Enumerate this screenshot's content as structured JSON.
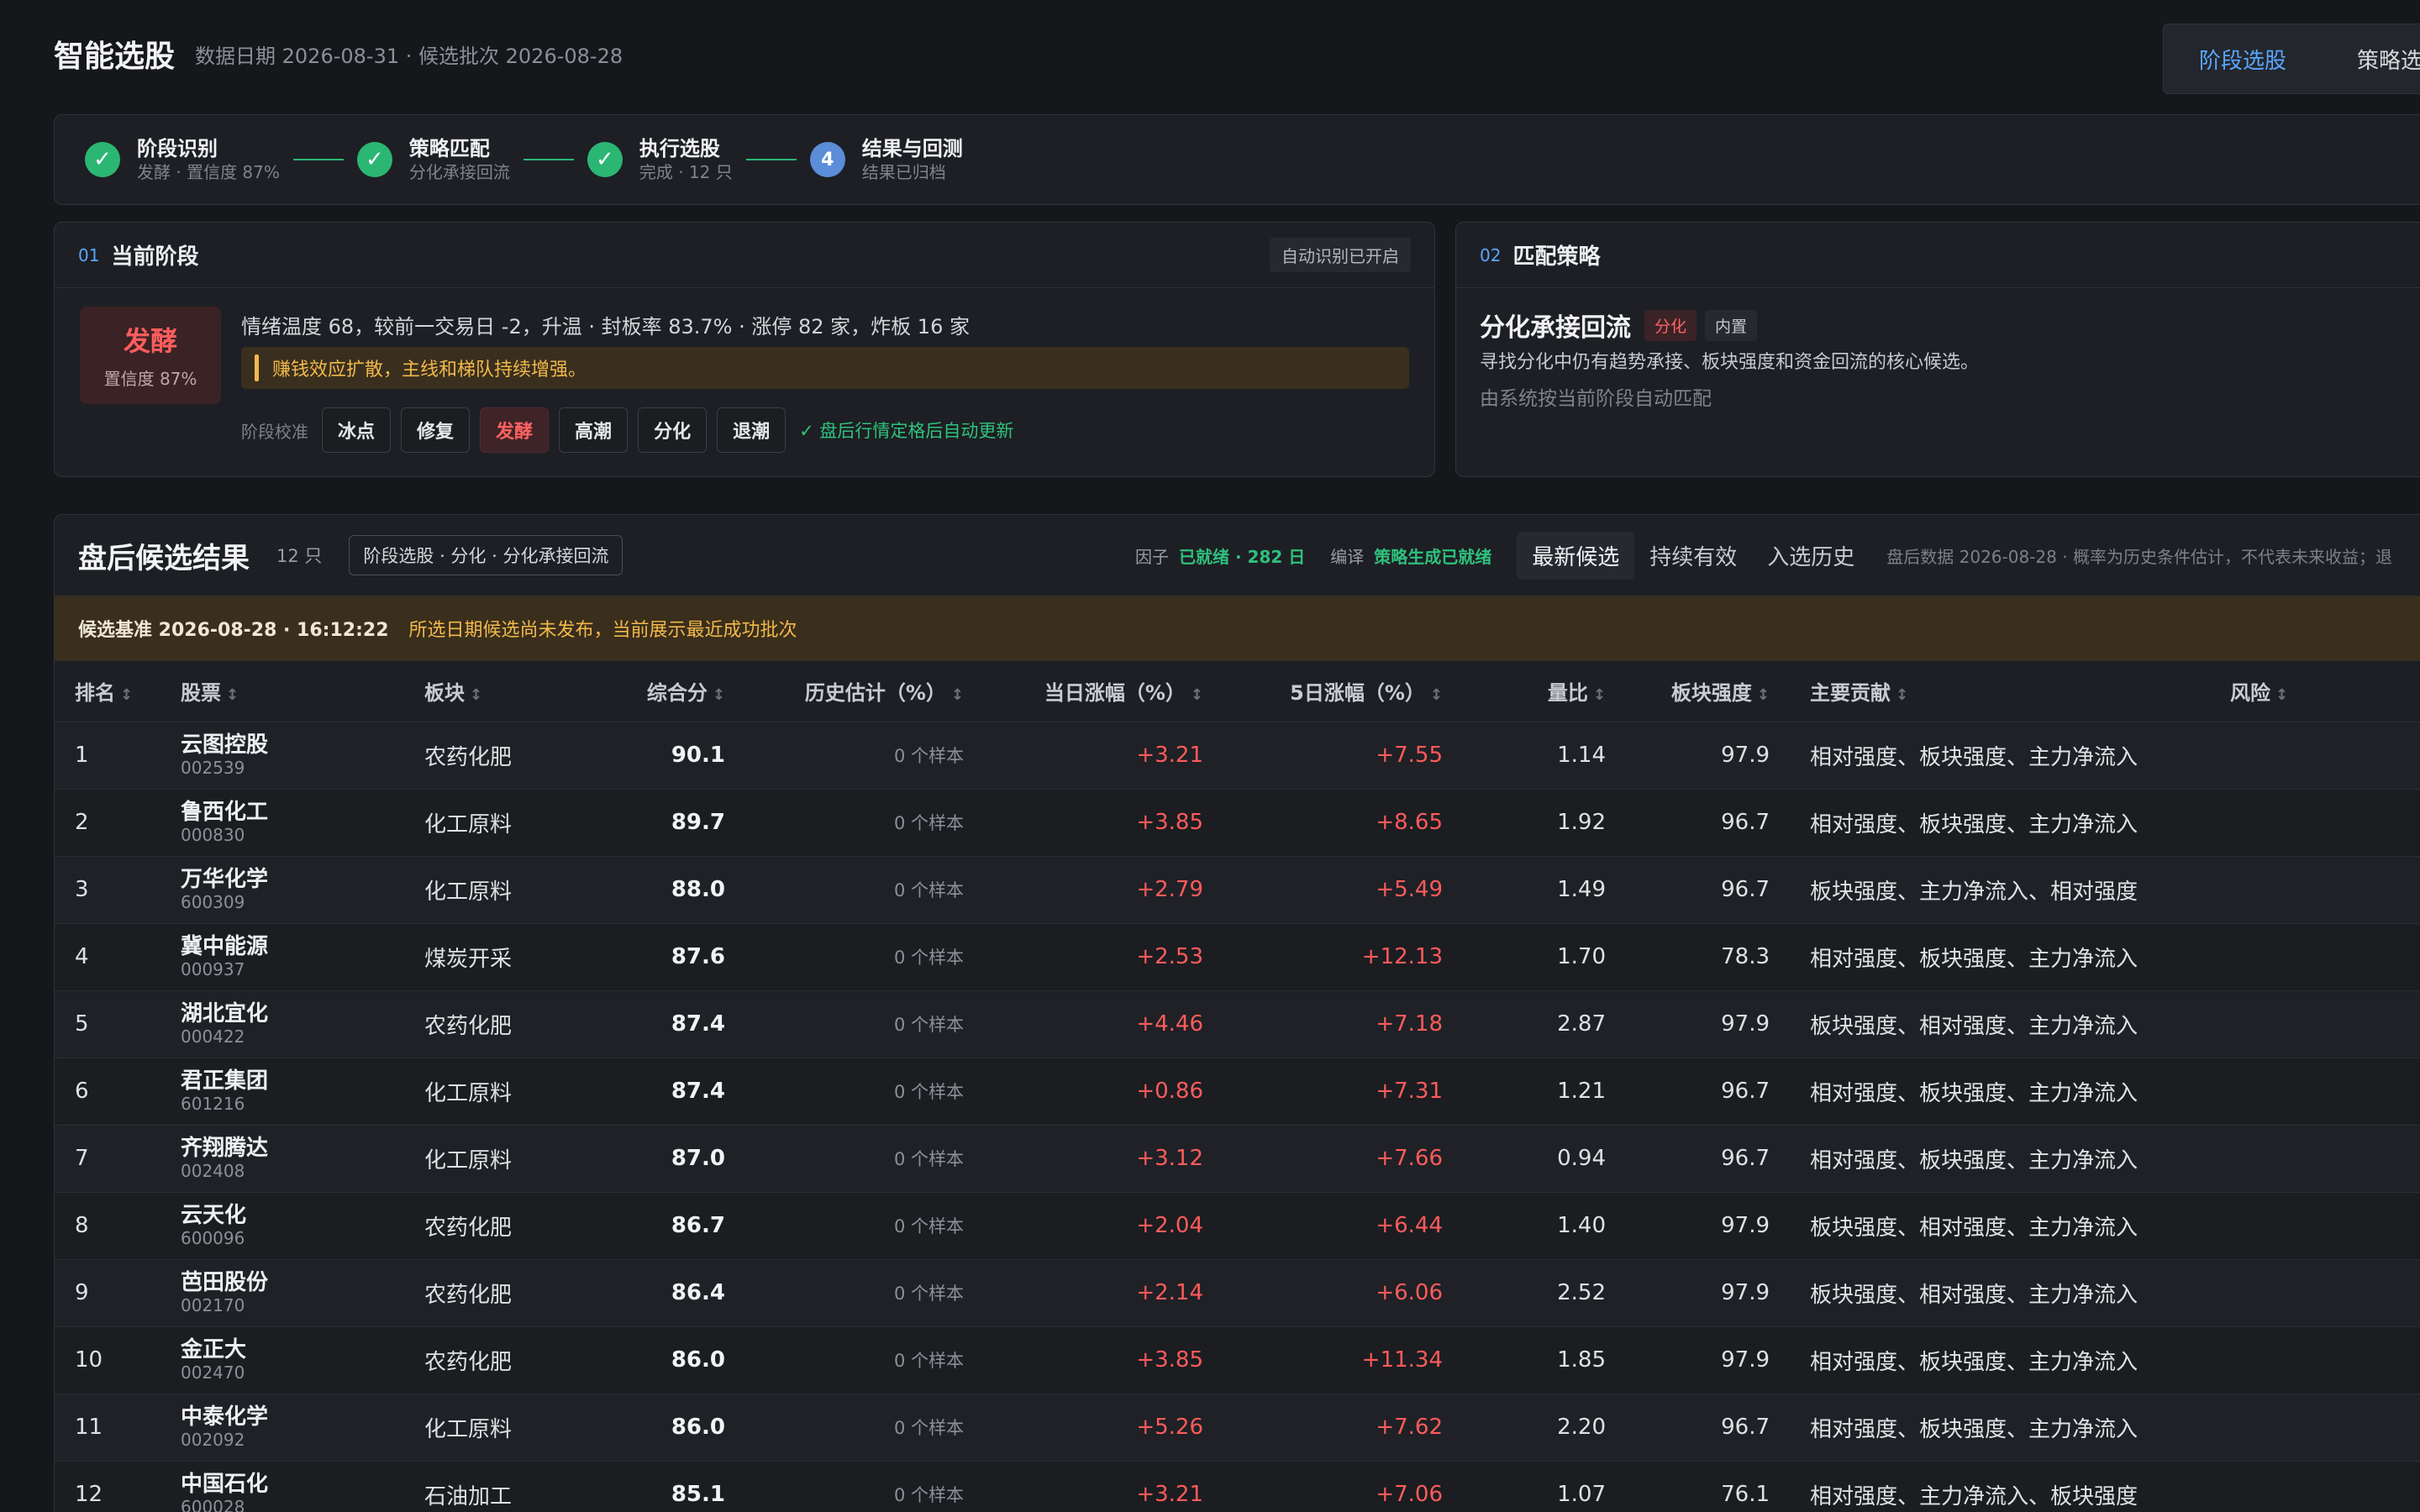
{
  "header": {
    "title": "智能选股",
    "meta": "数据日期 2026-08-31 · 候选批次 2026-08-28",
    "tabs": [
      "阶段选股",
      "策略选股"
    ]
  },
  "stepper": [
    {
      "title": "阶段识别",
      "sub": "发酵 · 置信度 87%",
      "state": "done"
    },
    {
      "title": "策略匹配",
      "sub": "分化承接回流",
      "state": "done"
    },
    {
      "title": "执行选股",
      "sub": "完成 · 12 只",
      "state": "done"
    },
    {
      "title": "结果与回测",
      "sub": "结果已归档",
      "state": "current",
      "number": "4"
    }
  ],
  "stage_panel": {
    "num": "01",
    "title": "当前阶段",
    "chip": "自动识别已开启",
    "badge_name": "发酵",
    "badge_conf": "置信度 87%",
    "desc": "情绪温度 68，较前一交易日 -2，升温 · 封板率 83.7% · 涨停 82 家，炸板 16 家",
    "alert": "赚钱效应扩散，主线和梯队持续增强。",
    "calib_label": "阶段校准",
    "calib_options": [
      "冰点",
      "修复",
      "发酵",
      "高潮",
      "分化",
      "退潮"
    ],
    "calib_active": "发酵",
    "calib_note": "✓ 盘后行情定格后自动更新"
  },
  "strategy_panel": {
    "num": "02",
    "title": "匹配策略",
    "name": "分化承接回流",
    "tag1": "分化",
    "tag2": "内置",
    "desc": "寻找分化中仍有趋势承接、板块强度和资金回流的核心候选。",
    "auto": "由系统按当前阶段自动匹配"
  },
  "results": {
    "title": "盘后候选结果",
    "count": "12 只",
    "scope": "阶段选股 · 分化 · 分化承接回流",
    "factor_label": "因子",
    "factor_status": "已就绪 · 282 日",
    "compile_label": "编译",
    "compile_status": "策略生成已就绪",
    "tabs": [
      "最新候选",
      "持续有效",
      "入选历史"
    ],
    "disclaimer": "盘后数据 2026-08-28 · 概率为历史条件估计，不代表未来收益；退",
    "warn_base": "候选基准 2026-08-28 · 16:12:22",
    "warn_msg": "所选日期候选尚未发布，当前展示最近成功批次",
    "columns": [
      "排名",
      "股票",
      "板块",
      "综合分",
      "历史估计（%）",
      "当日涨幅（%）",
      "5日涨幅（%）",
      "量比",
      "板块强度",
      "主要贡献",
      "风险"
    ],
    "rows": [
      {
        "rank": "1",
        "name": "云图控股",
        "code": "002539",
        "sector": "农药化肥",
        "score": "90.1",
        "hist": "0 个样本",
        "day": "+3.21",
        "five": "+7.55",
        "vol": "1.14",
        "strength": "97.9",
        "contrib": "相对强度、板块强度、主力净流入"
      },
      {
        "rank": "2",
        "name": "鲁西化工",
        "code": "000830",
        "sector": "化工原料",
        "score": "89.7",
        "hist": "0 个样本",
        "day": "+3.85",
        "five": "+8.65",
        "vol": "1.92",
        "strength": "96.7",
        "contrib": "相对强度、板块强度、主力净流入"
      },
      {
        "rank": "3",
        "name": "万华化学",
        "code": "600309",
        "sector": "化工原料",
        "score": "88.0",
        "hist": "0 个样本",
        "day": "+2.79",
        "five": "+5.49",
        "vol": "1.49",
        "strength": "96.7",
        "contrib": "板块强度、主力净流入、相对强度"
      },
      {
        "rank": "4",
        "name": "冀中能源",
        "code": "000937",
        "sector": "煤炭开采",
        "score": "87.6",
        "hist": "0 个样本",
        "day": "+2.53",
        "five": "+12.13",
        "vol": "1.70",
        "strength": "78.3",
        "contrib": "相对强度、板块强度、主力净流入"
      },
      {
        "rank": "5",
        "name": "湖北宜化",
        "code": "000422",
        "sector": "农药化肥",
        "score": "87.4",
        "hist": "0 个样本",
        "day": "+4.46",
        "five": "+7.18",
        "vol": "2.87",
        "strength": "97.9",
        "contrib": "板块强度、相对强度、主力净流入"
      },
      {
        "rank": "6",
        "name": "君正集团",
        "code": "601216",
        "sector": "化工原料",
        "score": "87.4",
        "hist": "0 个样本",
        "day": "+0.86",
        "five": "+7.31",
        "vol": "1.21",
        "strength": "96.7",
        "contrib": "相对强度、板块强度、主力净流入"
      },
      {
        "rank": "7",
        "name": "齐翔腾达",
        "code": "002408",
        "sector": "化工原料",
        "score": "87.0",
        "hist": "0 个样本",
        "day": "+3.12",
        "five": "+7.66",
        "vol": "0.94",
        "strength": "96.7",
        "contrib": "相对强度、板块强度、主力净流入"
      },
      {
        "rank": "8",
        "name": "云天化",
        "code": "600096",
        "sector": "农药化肥",
        "score": "86.7",
        "hist": "0 个样本",
        "day": "+2.04",
        "five": "+6.44",
        "vol": "1.40",
        "strength": "97.9",
        "contrib": "板块强度、相对强度、主力净流入"
      },
      {
        "rank": "9",
        "name": "芭田股份",
        "code": "002170",
        "sector": "农药化肥",
        "score": "86.4",
        "hist": "0 个样本",
        "day": "+2.14",
        "five": "+6.06",
        "vol": "2.52",
        "strength": "97.9",
        "contrib": "板块强度、相对强度、主力净流入"
      },
      {
        "rank": "10",
        "name": "金正大",
        "code": "002470",
        "sector": "农药化肥",
        "score": "86.0",
        "hist": "0 个样本",
        "day": "+3.85",
        "five": "+11.34",
        "vol": "1.85",
        "strength": "97.9",
        "contrib": "相对强度、板块强度、主力净流入"
      },
      {
        "rank": "11",
        "name": "中泰化学",
        "code": "002092",
        "sector": "化工原料",
        "score": "86.0",
        "hist": "0 个样本",
        "day": "+5.26",
        "five": "+7.62",
        "vol": "2.20",
        "strength": "96.7",
        "contrib": "相对强度、板块强度、主力净流入"
      },
      {
        "rank": "12",
        "name": "中国石化",
        "code": "600028",
        "sector": "石油加工",
        "score": "85.1",
        "hist": "0 个样本",
        "day": "+3.21",
        "five": "+7.06",
        "vol": "1.07",
        "strength": "76.1",
        "contrib": "相对强度、主力净流入、板块强度"
      }
    ]
  }
}
